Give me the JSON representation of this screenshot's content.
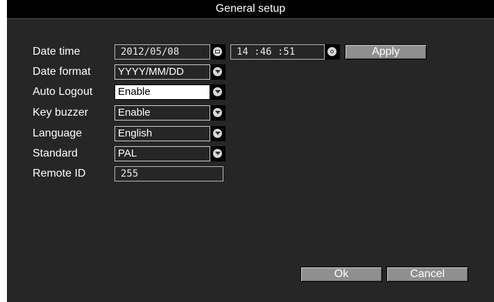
{
  "window": {
    "title": "General setup"
  },
  "rows": {
    "date_time": {
      "label": "Date time",
      "date_value": "2012/05/08",
      "time_value": "14 :46 :51"
    },
    "date_format": {
      "label": "Date format",
      "value": "YYYY/MM/DD"
    },
    "auto_logout": {
      "label": "Auto Logout",
      "value": "Enable"
    },
    "key_buzzer": {
      "label": "Key buzzer",
      "value": "Enable"
    },
    "language": {
      "label": "Language",
      "value": "English"
    },
    "standard": {
      "label": "Standard",
      "value": "PAL"
    },
    "remote_id": {
      "label": "Remote ID",
      "value": "255"
    }
  },
  "buttons": {
    "apply": "Apply",
    "ok": "Ok",
    "cancel": "Cancel"
  },
  "icons": {
    "date_picker": "calendar-icon",
    "time_picker": "clock-icon",
    "dropdown": "chevron-down-icon"
  },
  "colors": {
    "panel_bg": "#262626",
    "titlebar_bg": "#000000",
    "button_bg": "#8f8f8f",
    "text": "#ffffff"
  }
}
